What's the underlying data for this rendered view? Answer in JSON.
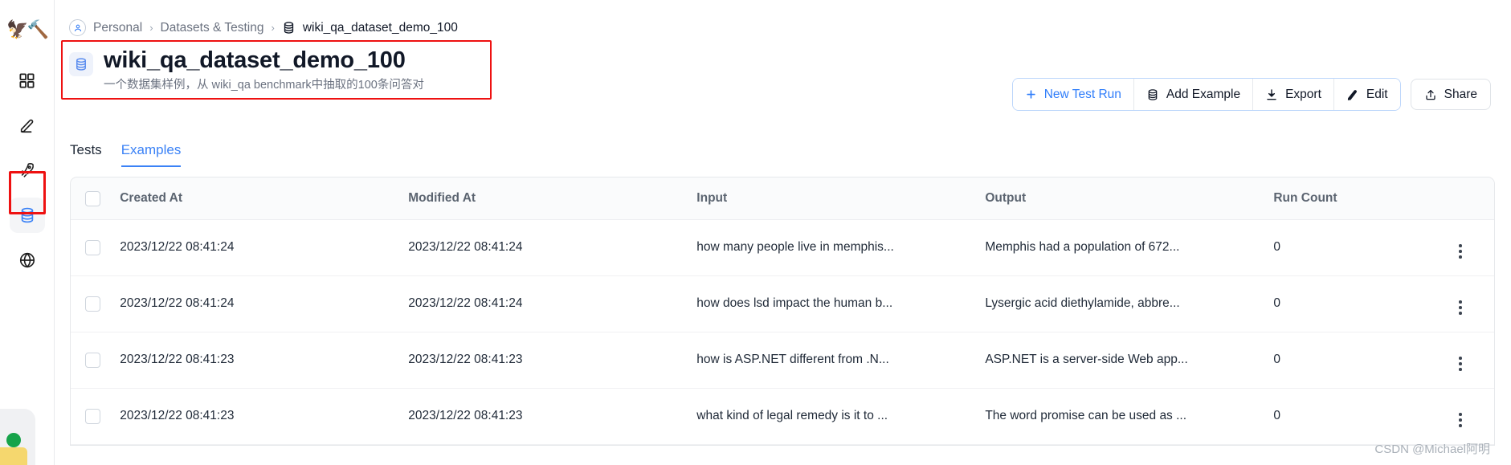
{
  "sidebar": {
    "logo_icon": "parrot-hammer-logo",
    "items": [
      {
        "icon": "grid-icon",
        "name": "dashboard",
        "active": false
      },
      {
        "icon": "pencil-icon",
        "name": "prompts",
        "active": false
      },
      {
        "icon": "rocket-icon",
        "name": "deployments",
        "active": false
      },
      {
        "icon": "database-icon",
        "name": "datasets",
        "active": true
      },
      {
        "icon": "globe-icon",
        "name": "public",
        "active": false
      }
    ],
    "status_dot_color": "#16a34a"
  },
  "breadcrumb": {
    "avatar_icon": "user-icon",
    "items": [
      {
        "label": "Personal",
        "current": false
      },
      {
        "label": "Datasets & Testing",
        "current": false
      },
      {
        "label": "wiki_qa_dataset_demo_100",
        "current": true,
        "icon": "database-icon"
      }
    ],
    "separator": "›"
  },
  "header": {
    "icon": "database-icon",
    "title": "wiki_qa_dataset_demo_100",
    "subtitle": "一个数据集样例，从 wiki_qa benchmark中抽取的100条问答对",
    "annotation_color": "#ee1111"
  },
  "toolbar": {
    "group1": [
      {
        "label": "New Test Run",
        "icon": "plus-icon",
        "primary": true
      },
      {
        "label": "Add Example",
        "icon": "database-icon",
        "primary": false
      },
      {
        "label": "Export",
        "icon": "download-icon",
        "primary": false
      },
      {
        "label": "Edit",
        "icon": "pencil-icon",
        "primary": false
      }
    ],
    "share": {
      "label": "Share",
      "icon": "share-upload-icon"
    },
    "accent_color": "#2f7dfa"
  },
  "tabs": [
    {
      "label": "Tests",
      "active": false
    },
    {
      "label": "Examples",
      "active": true
    }
  ],
  "table": {
    "columns": [
      "Created At",
      "Modified At",
      "Input",
      "Output",
      "Run Count"
    ],
    "rows": [
      {
        "created_at": "2023/12/22 08:41:24",
        "modified_at": "2023/12/22 08:41:24",
        "input": "how many people live in memphis...",
        "output": "Memphis had a population of 672...",
        "run_count": "0"
      },
      {
        "created_at": "2023/12/22 08:41:24",
        "modified_at": "2023/12/22 08:41:24",
        "input": "how does lsd impact the human b...",
        "output": "Lysergic acid diethylamide, abbre...",
        "run_count": "0"
      },
      {
        "created_at": "2023/12/22 08:41:23",
        "modified_at": "2023/12/22 08:41:23",
        "input": "how is ASP.NET different from .N...",
        "output": "ASP.NET is a server-side Web app...",
        "run_count": "0"
      },
      {
        "created_at": "2023/12/22 08:41:23",
        "modified_at": "2023/12/22 08:41:23",
        "input": "what kind of legal remedy is it to ...",
        "output": "The word promise can be used as ...",
        "run_count": "0"
      }
    ]
  },
  "watermark": "CSDN @Michael阿明"
}
